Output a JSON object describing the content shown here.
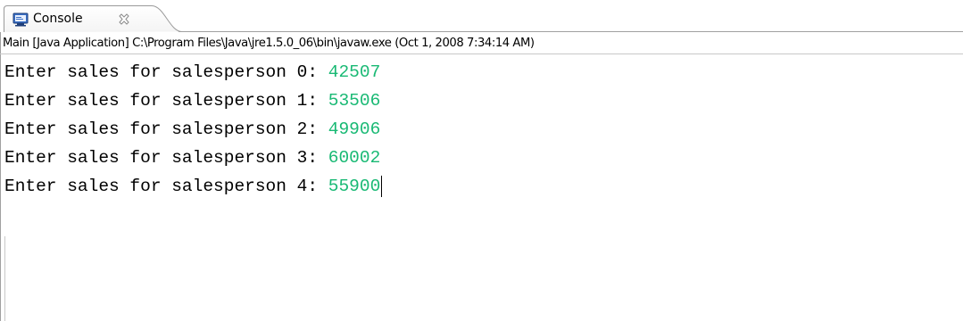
{
  "tab": {
    "label": "Console",
    "icon": "console-icon",
    "close_icon": "close-icon"
  },
  "description": "Main [Java Application] C:\\Program Files\\Java\\jre1.5.0_06\\bin\\javaw.exe (Oct 1, 2008 7:34:14 AM)",
  "console": {
    "lines": [
      {
        "prompt": "Enter sales for salesperson 0: ",
        "input": "42507"
      },
      {
        "prompt": "Enter sales for salesperson 1: ",
        "input": "53506"
      },
      {
        "prompt": "Enter sales for salesperson 2: ",
        "input": "49906"
      },
      {
        "prompt": "Enter sales for salesperson 3: ",
        "input": "60002"
      },
      {
        "prompt": "Enter sales for salesperson 4: ",
        "input": "55900"
      }
    ]
  },
  "colors": {
    "input_text": "#19b974",
    "output_text": "#000000"
  }
}
